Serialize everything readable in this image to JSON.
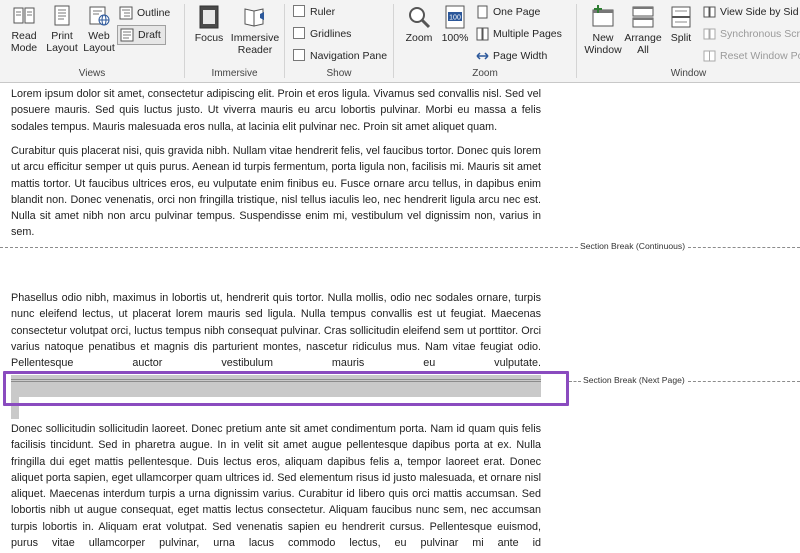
{
  "ribbon": {
    "views": {
      "label": "Views",
      "read_mode": "Read\nMode",
      "print_layout": "Print\nLayout",
      "web_layout": "Web\nLayout",
      "outline": "Outline",
      "draft": "Draft"
    },
    "immersive": {
      "label": "Immersive",
      "focus": "Focus",
      "immersive_reader": "Immersive\nReader"
    },
    "show": {
      "label": "Show",
      "ruler": "Ruler",
      "gridlines": "Gridlines",
      "navigation_pane": "Navigation Pane"
    },
    "zoom": {
      "label": "Zoom",
      "zoom": "Zoom",
      "percent": "100%",
      "icon_value": "100",
      "one_page": "One Page",
      "multiple_pages": "Multiple Pages",
      "page_width": "Page Width"
    },
    "window": {
      "label": "Window",
      "new_window": "New\nWindow",
      "arrange_all": "Arrange\nAll",
      "split": "Split",
      "view_side_by_side": "View Side by Sid",
      "synchronous_scrolling": "Synchronous Scr",
      "reset_window_position": "Reset Window Po"
    }
  },
  "document": {
    "para1": "Lorem ipsum dolor sit amet, consectetur adipiscing elit. Proin et eros ligula. Vivamus sed convallis nisl. Sed vel posuere mauris. Sed quis luctus justo. Ut viverra mauris eu arcu lobortis pulvinar. Morbi eu massa a felis sodales tempus. Mauris malesuada eros nulla, at lacinia elit pulvinar nec. Proin sit amet aliquet quam.",
    "para2": "Curabitur quis placerat nisi, quis gravida nibh. Nullam vitae hendrerit felis, vel faucibus tortor. Donec quis lorem ut arcu efficitur semper ut quis purus. Aenean id turpis fermentum, porta ligula non, facilisis mi. Mauris sit amet mattis tortor. Ut faucibus ultrices eros, eu vulputate enim finibus eu. Fusce ornare arcu tellus, in dapibus enim blandit non. Donec venenatis, orci non fringilla tristique, nisl tellus iaculis leo, nec hendrerit ligula arcu nec est. Nulla sit amet nibh non arcu pulvinar tempus. Suspendisse enim mi, vestibulum vel dignissim non, varius in sem.",
    "section_break_continuous": "Section Break (Continuous)",
    "para3": "Phasellus odio nibh, maximus in lobortis ut, hendrerit quis tortor. Nulla mollis, odio nec sodales ornare, turpis nunc eleifend lectus, ut placerat lorem mauris sed ligula. Nulla tempus convallis est ut feugiat. Maecenas consectetur volutpat orci, luctus tempus nibh consequat pulvinar. Cras sollicitudin eleifend sem ut porttitor. Orci varius natoque penatibus et magnis dis parturient montes, nascetur ridiculus mus. Nam vitae feugiat odio. Pellentesque auctor vestibulum mauris eu vulputate.",
    "section_break_next_page": "Section Break (Next Page)",
    "para4": "Donec sollicitudin sollicitudin laoreet. Donec pretium ante sit amet condimentum porta. Nam id quam quis felis facilisis tincidunt. Sed in pharetra augue. In in velit sit amet augue pellentesque dapibus porta at ex. Nulla fringilla dui eget mattis pellentesque. Duis lectus eros, aliquam dapibus felis a, tempor laoreet erat. Donec aliquet porta sapien, eget ullamcorper quam ultrices id. Sed elementum risus id justo malesuada, et ornare nisl aliquet. Maecenas interdum turpis a urna dignissim varius. Curabitur id libero quis orci mattis accumsan. Sed lobortis nibh ut augue consequat, eget mattis lectus consectetur. Aliquam faucibus nunc sem, nec accumsan turpis lobortis in. Aliquam erat volutpat. Sed venenatis sapien eu hendrerit cursus. Pellentesque euismod, purus vitae ullamcorper pulvinar, urna lacus commodo lectus, eu pulvinar mi ante id"
  },
  "colors": {
    "highlight": "#8a4bbf",
    "ribbon_bg": "#f3f3f3",
    "accent_blue": "#2b579a"
  }
}
